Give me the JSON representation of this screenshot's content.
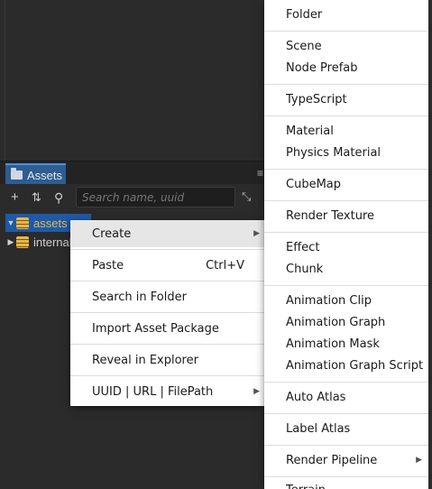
{
  "panel": {
    "tab_label": "Assets",
    "menu_icon": "≡",
    "search_placeholder": "Search name, uuid"
  },
  "tree": [
    {
      "label": "assets",
      "expanded": true,
      "selected": true
    },
    {
      "label": "internal",
      "expanded": false,
      "selected": false
    }
  ],
  "context_menu": {
    "create": "Create",
    "paste": "Paste",
    "paste_shortcut": "Ctrl+V",
    "search_in_folder": "Search in Folder",
    "import_asset_package": "Import Asset Package",
    "reveal_in_explorer": "Reveal in Explorer",
    "uuid_url_filepath": "UUID | URL | FilePath"
  },
  "submenu": {
    "folder": "Folder",
    "scene": "Scene",
    "node_prefab": "Node Prefab",
    "typescript": "TypeScript",
    "material": "Material",
    "physics_material": "Physics Material",
    "cubemap": "CubeMap",
    "render_texture": "Render Texture",
    "effect": "Effect",
    "chunk": "Chunk",
    "animation_clip": "Animation Clip",
    "animation_graph": "Animation Graph",
    "animation_mask": "Animation Mask",
    "animation_graph_script": "Animation Graph Script",
    "auto_atlas": "Auto Atlas",
    "label_atlas": "Label Atlas",
    "render_pipeline": "Render Pipeline",
    "terrain": "Terrain"
  },
  "icons": {
    "add": "+",
    "sort": "⇅",
    "search": "⚲",
    "collapse": "⤡",
    "submenu_arrow": "▶"
  }
}
